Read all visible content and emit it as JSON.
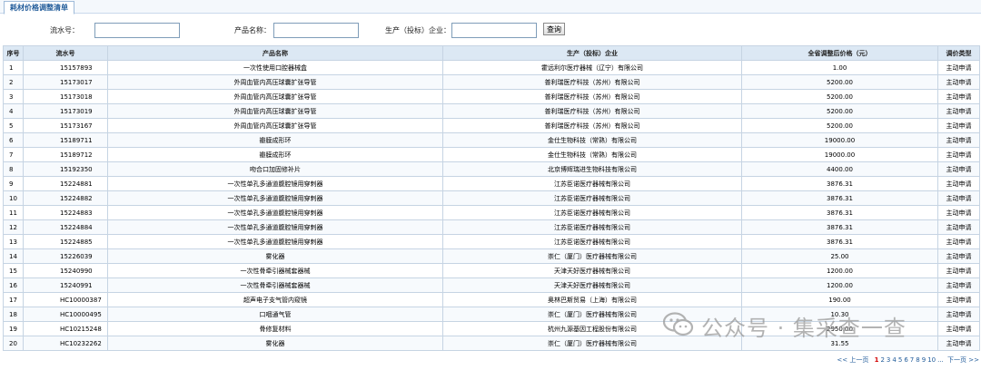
{
  "tab_title": "耗材价格调整清单",
  "search": {
    "serial_label": "流水号：",
    "product_label": "产品名称：",
    "company_label": "生产（投标）企业：",
    "query_button": "查询"
  },
  "table": {
    "headers": [
      "序号",
      "流水号",
      "产品名称",
      "生产（投标）企业",
      "全省调整后价格（元）",
      "调价类型"
    ],
    "rows": [
      [
        "1",
        "15157893",
        "一次性使用口腔器械盒",
        "霍远利尔医疗器械（辽宁）有限公司",
        "1.00",
        "主动申请"
      ],
      [
        "2",
        "15173017",
        "外周血管内高压球囊扩张导管",
        "普利瑞医疗科技（苏州）有限公司",
        "5200.00",
        "主动申请"
      ],
      [
        "3",
        "15173018",
        "外周血管内高压球囊扩张导管",
        "普利瑞医疗科技（苏州）有限公司",
        "5200.00",
        "主动申请"
      ],
      [
        "4",
        "15173019",
        "外周血管内高压球囊扩张导管",
        "普利瑞医疗科技（苏州）有限公司",
        "5200.00",
        "主动申请"
      ],
      [
        "5",
        "15173167",
        "外周血管内高压球囊扩张导管",
        "普利瑞医疗科技（苏州）有限公司",
        "5200.00",
        "主动申请"
      ],
      [
        "6",
        "15189711",
        "瓣膜成形环",
        "金仕生物科技（常熟）有限公司",
        "19000.00",
        "主动申请"
      ],
      [
        "7",
        "15189712",
        "瓣膜成形环",
        "金仕生物科技（常熟）有限公司",
        "19000.00",
        "主动申请"
      ],
      [
        "8",
        "15192350",
        "吻合口加固修补片",
        "北京博辉瑞进生物科技有限公司",
        "4400.00",
        "主动申请"
      ],
      [
        "9",
        "15224881",
        "一次性单孔多通道腹腔镜用穿刺器",
        "江苏臣诺医疗器械有限公司",
        "3876.31",
        "主动申请"
      ],
      [
        "10",
        "15224882",
        "一次性单孔多通道腹腔镜用穿刺器",
        "江苏臣诺医疗器械有限公司",
        "3876.31",
        "主动申请"
      ],
      [
        "11",
        "15224883",
        "一次性单孔多通道腹腔镜用穿刺器",
        "江苏臣诺医疗器械有限公司",
        "3876.31",
        "主动申请"
      ],
      [
        "12",
        "15224884",
        "一次性单孔多通道腹腔镜用穿刺器",
        "江苏臣诺医疗器械有限公司",
        "3876.31",
        "主动申请"
      ],
      [
        "13",
        "15224885",
        "一次性单孔多通道腹腔镜用穿刺器",
        "江苏臣诺医疗器械有限公司",
        "3876.31",
        "主动申请"
      ],
      [
        "14",
        "15226039",
        "雾化器",
        "崇仁（厦门）医疗器械有限公司",
        "25.00",
        "主动申请"
      ],
      [
        "15",
        "15240990",
        "一次性骨牵引器械套器械",
        "天津天好医疗器械有限公司",
        "1200.00",
        "主动申请"
      ],
      [
        "16",
        "15240991",
        "一次性骨牵引器械套器械",
        "天津天好医疗器械有限公司",
        "1200.00",
        "主动申请"
      ],
      [
        "17",
        "HC10000387",
        "超声电子支气管内窥镜",
        "奥林巴斯贸易（上海）有限公司",
        "190.00",
        "主动申请"
      ],
      [
        "18",
        "HC10000495",
        "口咽通气管",
        "崇仁（厦门）医疗器械有限公司",
        "10.30",
        "主动申请"
      ],
      [
        "19",
        "HC10215248",
        "骨修复材料",
        "杭州九源基因工程股份有限公司",
        "2950.00",
        "主动申请"
      ],
      [
        "20",
        "HC10232262",
        "雾化器",
        "崇仁（厦门）医疗器械有限公司",
        "31.55",
        "主动申请"
      ]
    ]
  },
  "pagination": {
    "prev": "<< 上一页",
    "pages": [
      "1",
      "2",
      "3",
      "4",
      "5",
      "6",
      "7",
      "8",
      "9",
      "10",
      "..."
    ],
    "current": "1",
    "next": "下一页 >>"
  },
  "watermark": {
    "text": "公众号 · 集采查一查",
    "icon": "wechat-icon"
  }
}
